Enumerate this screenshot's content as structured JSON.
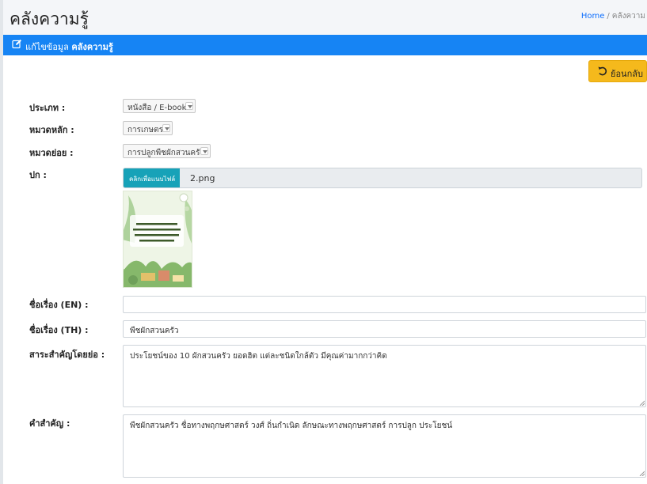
{
  "header": {
    "title": "คลังความรู้",
    "breadcrumb_home": "Home",
    "breadcrumb_separator": "/",
    "breadcrumb_current": "คลังความ"
  },
  "panel": {
    "header_prefix": "แก้ไขข้อมูล",
    "header_bold": "คลังความรู้",
    "accent_color": "#1684f4"
  },
  "toolbar": {
    "back_label": "ย้อนกลับ",
    "back_color": "#f5b91c",
    "back_icon": "undo-arrow-icon"
  },
  "form": {
    "type_label": "ประเภท :",
    "type_value": "หนังสือ / E-book",
    "main_category_label": "หมวดหลัก :",
    "main_category_value": "การเกษตร",
    "sub_category_label": "หมวดย่อย :",
    "sub_category_value": "การปลูกพืชผักสวนครัว",
    "cover_label": "ปก :",
    "file_button_label": "คลิกเพื่อแนบไฟล์",
    "file_name": "2.png",
    "cover_image_text": "หนังสือความรู้เรื่องการปลูกผักสวนครัว",
    "title_en_label": "ชื่อเรื่อง (EN) :",
    "title_en_value": "",
    "title_th_label": "ชื่อเรื่อง (TH) :",
    "title_th_value": "พืชผักสวนครัว",
    "abstract_label": "สาระสำคัญโดยย่อ :",
    "abstract_value": "ประโยชน์ของ 10 ผักสวนครัว ยอดฮิต แต่ละชนิดใกล้ตัว มีคุณค่ามากกว่าคิด",
    "keywords_label": "คำสำคัญ :",
    "keywords_value": "พืชผักสวนครัว ชื่อทางพฤกษศาสตร์ วงศ์ ถิ่นกำเนิด ลักษณะทางพฤกษศาสตร์ การปลูก ประโยชน์"
  }
}
